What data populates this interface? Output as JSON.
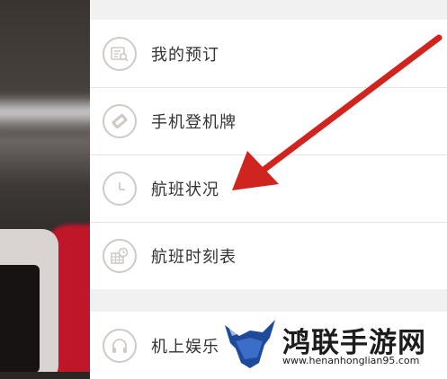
{
  "menu": {
    "items": [
      {
        "label": "我的预订",
        "icon": "booking-icon"
      },
      {
        "label": "手机登机牌",
        "icon": "boarding-pass-icon"
      },
      {
        "label": "航班状况",
        "icon": "clock-icon"
      },
      {
        "label": "航班时刻表",
        "icon": "schedule-icon"
      },
      {
        "label": "机上娱乐",
        "icon": "headphones-icon"
      }
    ]
  },
  "annotation": {
    "color": "#d0241e",
    "points_to": "航班状况"
  },
  "watermark": {
    "title": "鸿联手游网",
    "url": "www.henanhonglian95.com"
  },
  "colors": {
    "drawer_bg": "#f1f1f1",
    "item_bg": "#ffffff",
    "icon_stroke": "#cfcac5",
    "text": "#333333",
    "logo_blue": "#1e4a9c"
  }
}
